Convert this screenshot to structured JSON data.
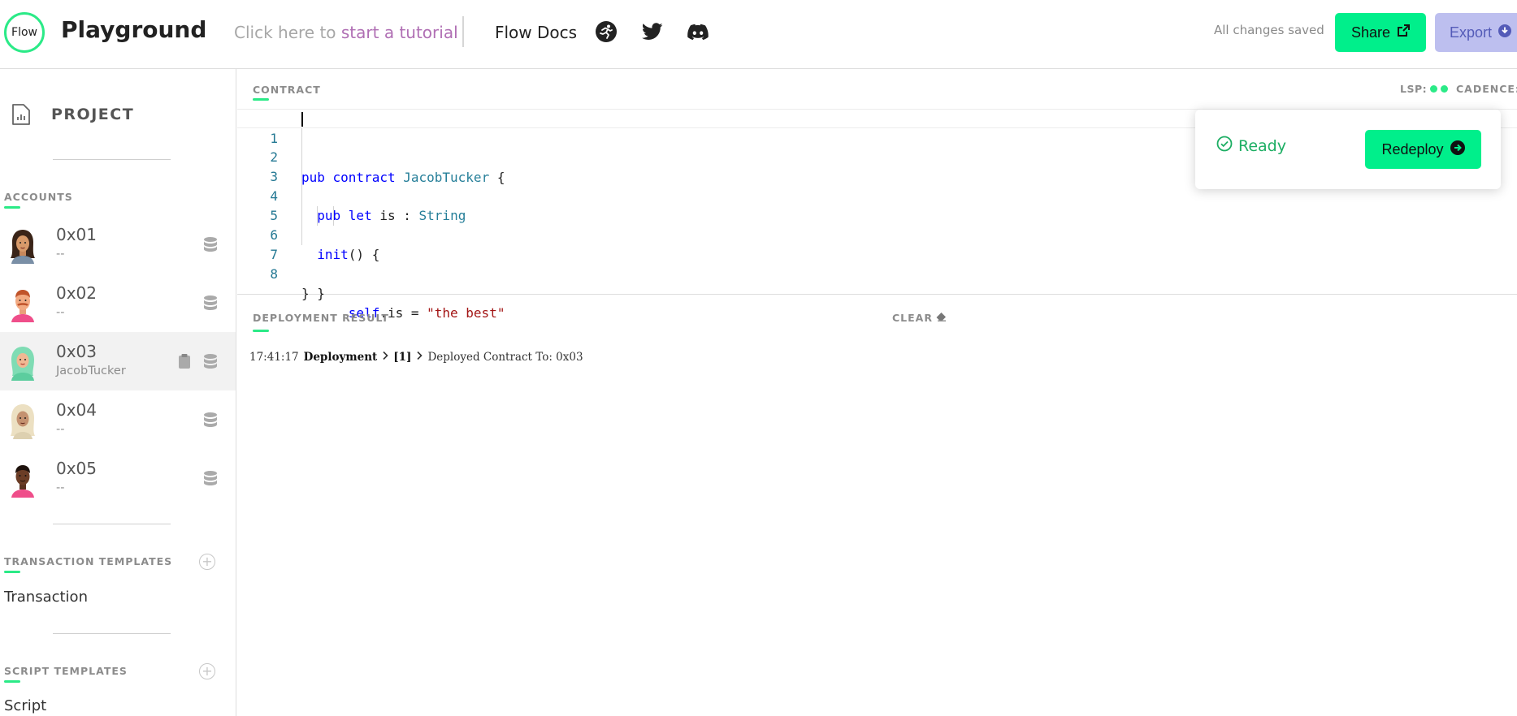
{
  "header": {
    "logo_text": "Flow",
    "title": "Playground",
    "tutorial_prefix": "Click here to",
    "tutorial_link": "start a tutorial",
    "docs": "Flow Docs",
    "icons": [
      "flow-runner-icon",
      "twitter-icon",
      "discord-icon"
    ],
    "status": "All changes saved",
    "share_label": "Share",
    "export_label": "Export"
  },
  "sidebar": {
    "project_label": "PROJECT",
    "accounts_label": "ACCOUNTS",
    "accounts": [
      {
        "address": "0x01",
        "contract": "--",
        "selected": false
      },
      {
        "address": "0x02",
        "contract": "--",
        "selected": false
      },
      {
        "address": "0x03",
        "contract": "JacobTucker",
        "selected": true
      },
      {
        "address": "0x04",
        "contract": "--",
        "selected": false
      },
      {
        "address": "0x05",
        "contract": "--",
        "selected": false
      }
    ],
    "transaction_templates_label": "TRANSACTION TEMPLATES",
    "transaction_templates": [
      "Transaction"
    ],
    "script_templates_label": "SCRIPT TEMPLATES",
    "script_templates": [
      "Script"
    ]
  },
  "editor": {
    "label": "CONTRACT",
    "lsp_label": "LSP:",
    "cadence_label": "CADENCE:",
    "line_numbers": [
      "1",
      "2",
      "3",
      "4",
      "5",
      "6",
      "7",
      "8"
    ],
    "code": [
      "pub contract JacobTucker {",
      "",
      "  pub let is : String",
      "",
      "  init() {",
      "      self.is = \"the best\"",
      "  }",
      "}"
    ],
    "status_text": "Ready",
    "redeploy_label": "Redeploy"
  },
  "result": {
    "label": "DEPLOYMENT RESULT",
    "clear_label": "CLEAR",
    "log": {
      "time": "17:41:17",
      "type": "Deployment",
      "index": "[1]",
      "message": "Deployed Contract To: 0x03"
    }
  },
  "colors": {
    "accent": "#00ef8b",
    "export_bg": "#bdbfef",
    "tutorial_link": "#b06fb4",
    "ready": "#1cae63"
  }
}
